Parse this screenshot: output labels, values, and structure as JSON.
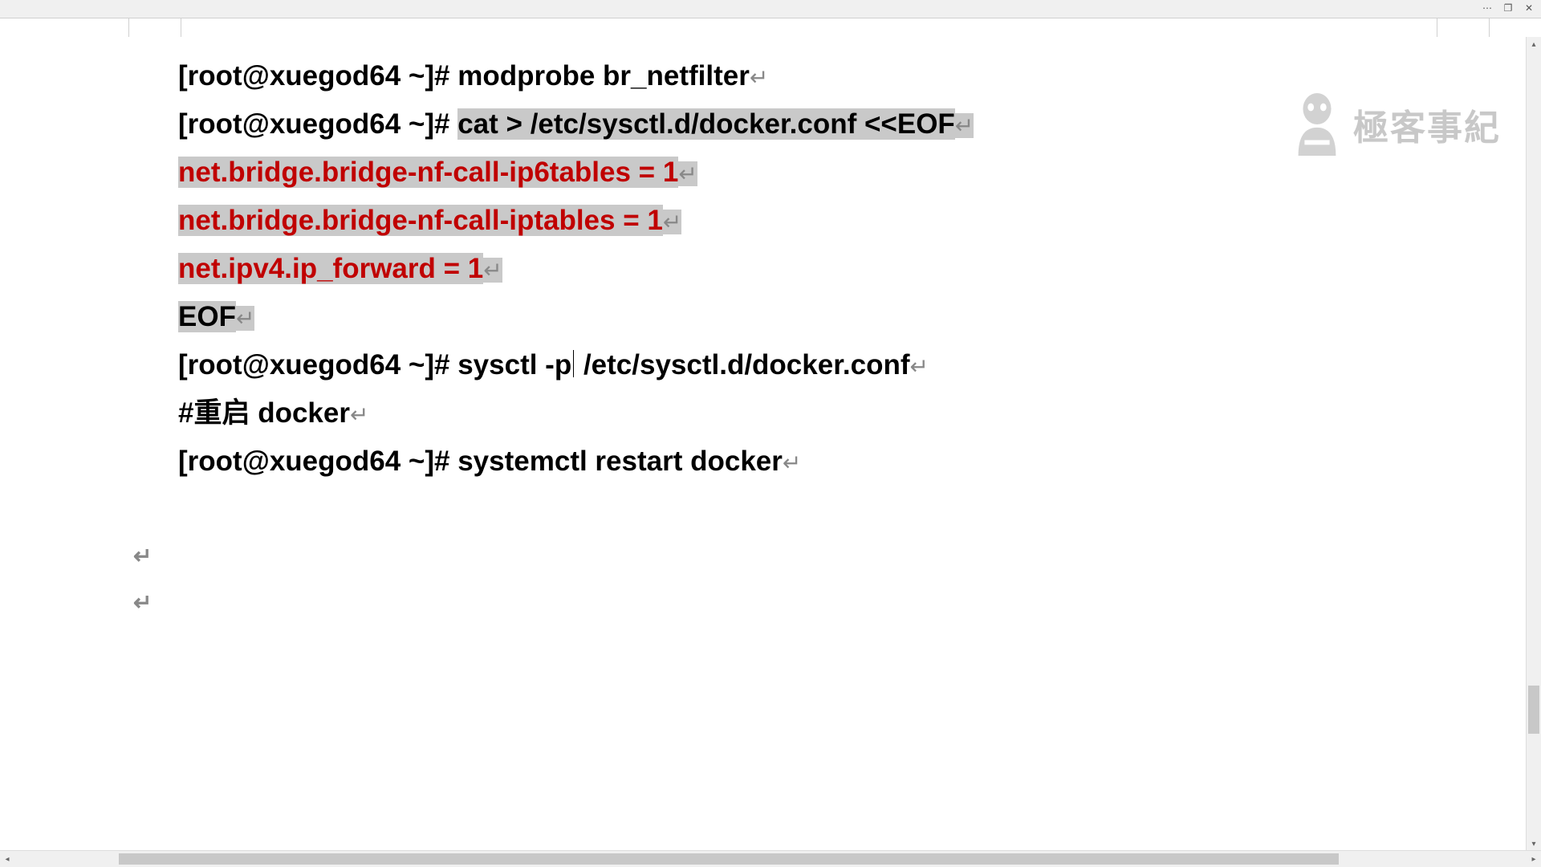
{
  "prompt": "[root@xuegod64 ~]# ",
  "lines": {
    "l1_cmd": "modprobe br_netfilter",
    "l2_cmd": "cat > /etc/sysctl.d/docker.conf <<EOF",
    "l3": "net.bridge.bridge-nf-call-ip6tables = 1",
    "l4": "net.bridge.bridge-nf-call-iptables = 1",
    "l5": "net.ipv4.ip_forward = 1",
    "l6": "EOF",
    "l7_cmd_a": "sysctl -p",
    "l7_cmd_b": " /etc/sysctl.d/docker.conf",
    "l8": "#重启 docker",
    "l9_cmd": "systemctl restart docker"
  },
  "enter_mark": "↵",
  "para_mark": "↵",
  "watermark_text": "極客事紀",
  "titlebar": {
    "more": "⋯",
    "restore": "❐",
    "close": "✕"
  },
  "scroll": {
    "up": "▴",
    "down": "▾",
    "left": "◂",
    "right": "▸"
  }
}
